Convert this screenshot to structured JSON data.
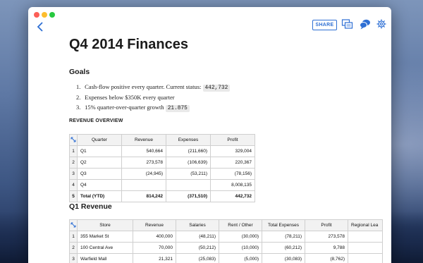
{
  "window": {
    "share_label": "SHARE"
  },
  "document": {
    "title": "Q4 2014 Finances",
    "goals_heading": "Goals",
    "goals": [
      {
        "num": "1.",
        "text": "Cash-flow positive every quarter. Current status:",
        "code": "442,732"
      },
      {
        "num": "2.",
        "text": "Expenses below $350K every quarter",
        "code": ""
      },
      {
        "num": "3.",
        "text": "15% quarter-over-quarter growth",
        "code": "21.875"
      }
    ],
    "revenue_overview_heading": "REVENUE OVERVIEW",
    "q1_heading": "Q1 Revenue"
  },
  "revenue_table": {
    "headers": [
      "Quarter",
      "Revenue",
      "Expenses",
      "Profit"
    ],
    "rows": [
      {
        "n": "1",
        "cells": [
          "Q1",
          "540,664",
          "(211,660)",
          "329,004"
        ]
      },
      {
        "n": "2",
        "cells": [
          "Q2",
          "273,578",
          "(106,639)",
          "220,367"
        ]
      },
      {
        "n": "3",
        "cells": [
          "Q3",
          "(24,945)",
          "(53,211)",
          "(78,156)"
        ]
      },
      {
        "n": "4",
        "cells": [
          "Q4",
          "",
          "",
          "8,008,135"
        ]
      },
      {
        "n": "5",
        "cells": [
          "Total (YTD)",
          "814,242",
          "(371,510)",
          "442,732"
        ]
      }
    ]
  },
  "q1_table": {
    "headers": [
      "Store",
      "Revenue",
      "Salaries",
      "Rent / Other",
      "Total Expenses",
      "Profit",
      "Regional Lea"
    ],
    "rows": [
      {
        "n": "1",
        "cells": [
          "355 Market St",
          "400,000",
          "(48,211)",
          "(30,000)",
          "(78,211)",
          "273,578",
          ""
        ]
      },
      {
        "n": "2",
        "cells": [
          "100 Central Ave",
          "70,000",
          "(50,212)",
          "(10,000)",
          "(60,212)",
          "9,788",
          ""
        ]
      },
      {
        "n": "3",
        "cells": [
          "Warfield Mall",
          "21,321",
          "(25,083)",
          "(5,000)",
          "(30,083)",
          "(8,762)",
          ""
        ]
      }
    ]
  },
  "icons": {
    "back": "chevron-left-icon",
    "present": "present-screens-icon",
    "comments": "comments-icon",
    "settings": "gear-icon"
  },
  "colors": {
    "accent": "#2e6fd4",
    "window_bg": "#ffffff"
  }
}
